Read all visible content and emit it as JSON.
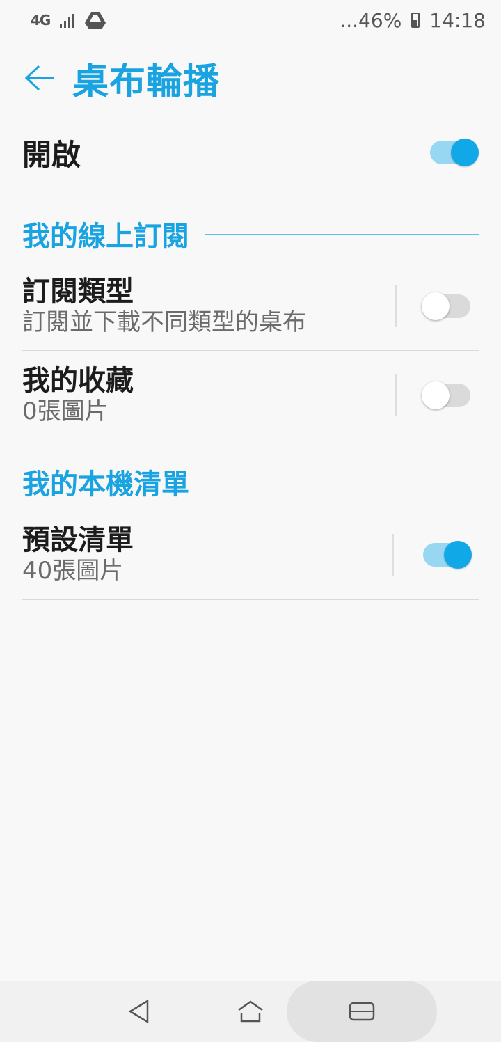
{
  "status_bar": {
    "network": "4G",
    "battery_text": "...46%",
    "time": "14:18",
    "icons": [
      "signal-icon",
      "drive-icon",
      "battery-icon"
    ]
  },
  "app_bar": {
    "back_icon": "arrow-left-icon",
    "title": "桌布輪播"
  },
  "master_toggle": {
    "label": "開啟",
    "on": true
  },
  "sections": [
    {
      "title": "我的線上訂閱",
      "items": [
        {
          "title": "訂閱類型",
          "subtitle": "訂閱並下載不同類型的桌布",
          "on": false
        },
        {
          "title": "我的收藏",
          "subtitle": "0張圖片",
          "on": false
        }
      ]
    },
    {
      "title": "我的本機清單",
      "items": [
        {
          "title": "預設清單",
          "subtitle": "40張圖片",
          "on": true
        }
      ]
    }
  ],
  "nav_bar": {
    "icons": [
      "back-triangle-icon",
      "home-icon",
      "recent-apps-icon"
    ]
  },
  "colors": {
    "accent": "#1aa3e1",
    "toggle_on_thumb": "#11a8e8",
    "toggle_on_track": "#97d7f1",
    "toggle_off_track": "#dadada"
  }
}
